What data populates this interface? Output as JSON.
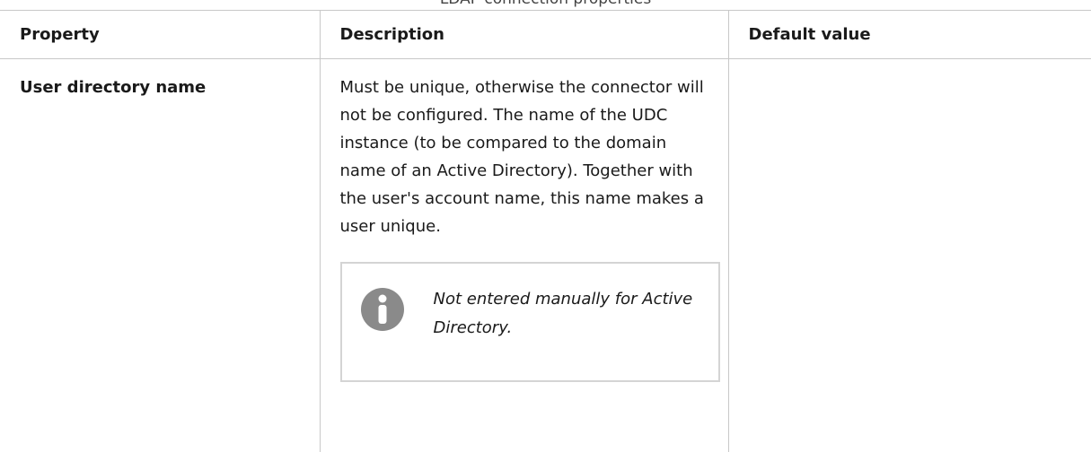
{
  "caption": "LDAP connection properties",
  "table": {
    "headers": [
      "Property",
      "Description",
      "Default value"
    ],
    "rows": [
      {
        "property": "User directory name",
        "description": "Must be unique, otherwise the connector will not be configured. The name of the UDC instance (to be compared to the domain name of an Active Directory). Together with the user's account name, this name makes a user unique.",
        "default_value": ""
      }
    ]
  },
  "note": {
    "icon": "info-icon",
    "text": "Not entered manually for Active Directory."
  },
  "colors": {
    "border": "#c8c8c8",
    "note_border": "#d4d4d4",
    "icon": "#8a8a8a"
  }
}
